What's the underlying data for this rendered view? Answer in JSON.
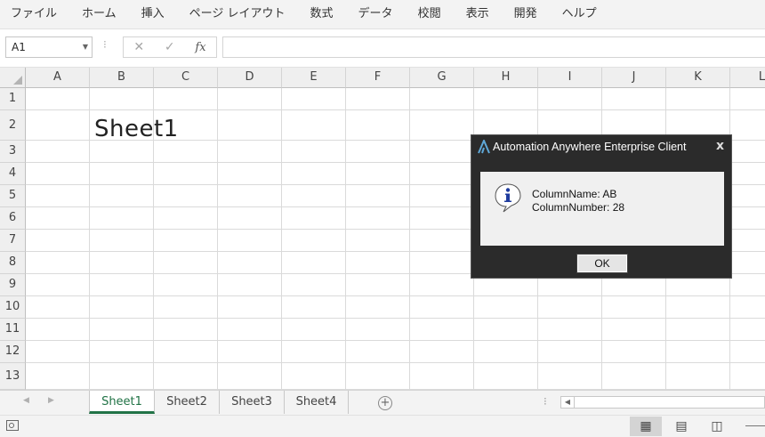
{
  "ribbon": {
    "menu": [
      "ファイル",
      "ホーム",
      "挿入",
      "ページ レイアウト",
      "数式",
      "データ",
      "校閲",
      "表示",
      "開発",
      "ヘルプ"
    ]
  },
  "formula_bar": {
    "name_box": "A1",
    "formula": ""
  },
  "grid": {
    "columns": [
      "A",
      "B",
      "C",
      "D",
      "E",
      "F",
      "G",
      "H",
      "I",
      "J",
      "K",
      "L"
    ],
    "rows": [
      "1",
      "2",
      "3",
      "4",
      "5",
      "6",
      "7",
      "8",
      "9",
      "10",
      "11",
      "12",
      "13"
    ],
    "cell_B2": "Sheet1"
  },
  "sheet_tabs": [
    "Sheet1",
    "Sheet2",
    "Sheet3",
    "Sheet4"
  ],
  "active_sheet": "Sheet1",
  "dialog": {
    "title": "Automation Anywhere Enterprise Client",
    "close": "x",
    "line1": "ColumnName: AB",
    "line2": "ColumnNumber: 28",
    "ok": "OK"
  },
  "colors": {
    "excel_green": "#217346",
    "dialog_dark": "#2b2b2b",
    "info_icon_blue": "#1f3c9e"
  }
}
